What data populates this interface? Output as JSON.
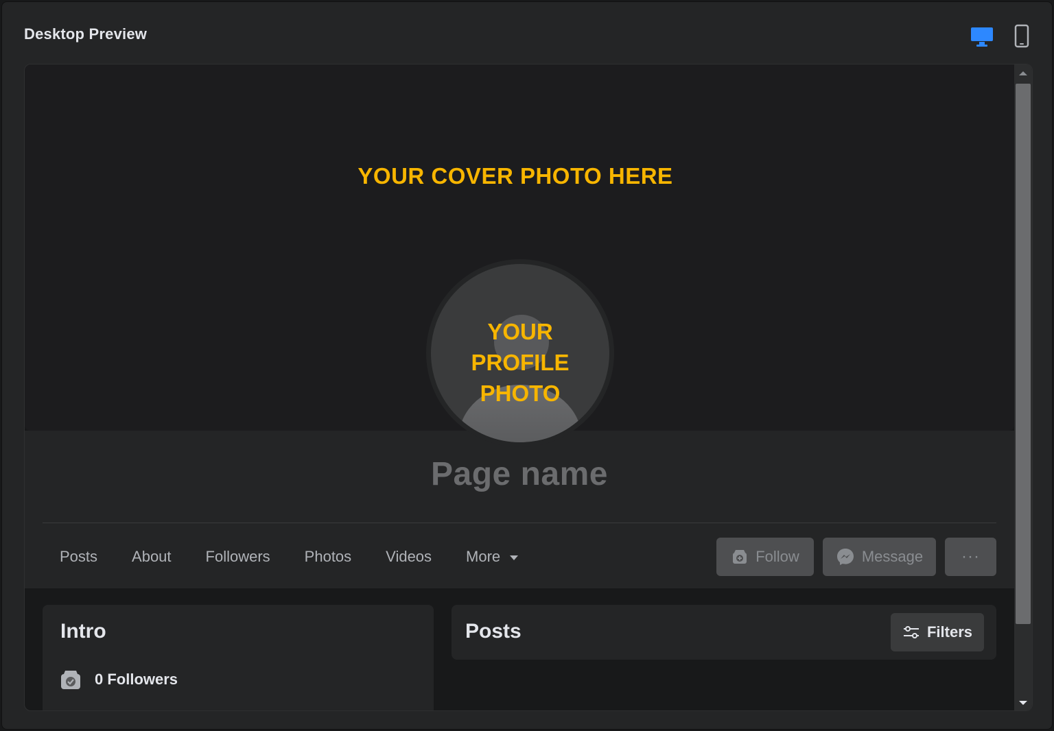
{
  "window": {
    "title": "Desktop Preview",
    "view_modes": [
      {
        "name": "desktop",
        "icon": "desktop-monitor-icon",
        "active": true,
        "color": "#2d88ff"
      },
      {
        "name": "mobile",
        "icon": "mobile-phone-icon",
        "active": false,
        "color": "#b0b3b8"
      }
    ]
  },
  "cover": {
    "placeholder_text": "YOUR COVER PHOTO HERE",
    "accent_color": "#f7b500"
  },
  "profile": {
    "placeholder_lines": [
      "YOUR",
      "PROFILE",
      "PHOTO"
    ],
    "page_name": "Page name"
  },
  "tabs": [
    {
      "label": "Posts"
    },
    {
      "label": "About"
    },
    {
      "label": "Followers"
    },
    {
      "label": "Photos"
    },
    {
      "label": "Videos"
    },
    {
      "label": "More",
      "has_dropdown": true
    }
  ],
  "actions": {
    "follow_label": "Follow",
    "follow_icon": "follow-plus-icon",
    "message_label": "Message",
    "message_icon": "messenger-icon",
    "more_label": "···"
  },
  "intro": {
    "title": "Intro",
    "followers_text": "0 Followers",
    "followers_icon": "followers-check-icon"
  },
  "posts": {
    "title": "Posts",
    "filters_label": "Filters",
    "filters_icon": "sliders-icon"
  }
}
